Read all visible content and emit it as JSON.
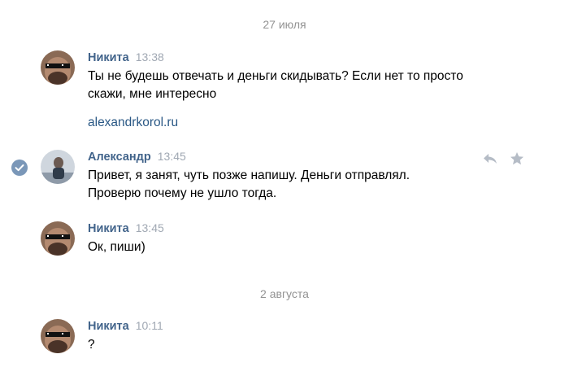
{
  "date_separators": [
    "27 июля",
    "2 августа"
  ],
  "messages": [
    {
      "author": "Никита",
      "time": "13:38",
      "text": "Ты не будешь отвечать и деньги скидывать? Если нет то просто\nскажи, мне интересно",
      "link": "alexandrkorol.ru"
    },
    {
      "author": "Александр",
      "time": "13:45",
      "text": "Привет, я занят, чуть позже напишу. Деньги отправлял.\nПроверю почему не ушло тогда."
    },
    {
      "author": "Никита",
      "time": "13:45",
      "text": "Ок, пиши)"
    },
    {
      "author": "Никита",
      "time": "10:11",
      "text": "?"
    }
  ],
  "icons": {
    "selected": "checkmark-icon",
    "reply": "reply-icon",
    "favorite": "star-icon"
  },
  "colors": {
    "author_name": "#42648b",
    "timestamp": "#a0a8b3",
    "link": "#2a5885",
    "date_separator": "#939393",
    "check_badge": "#7a97b8",
    "action_icons": "#b5bcc6"
  }
}
